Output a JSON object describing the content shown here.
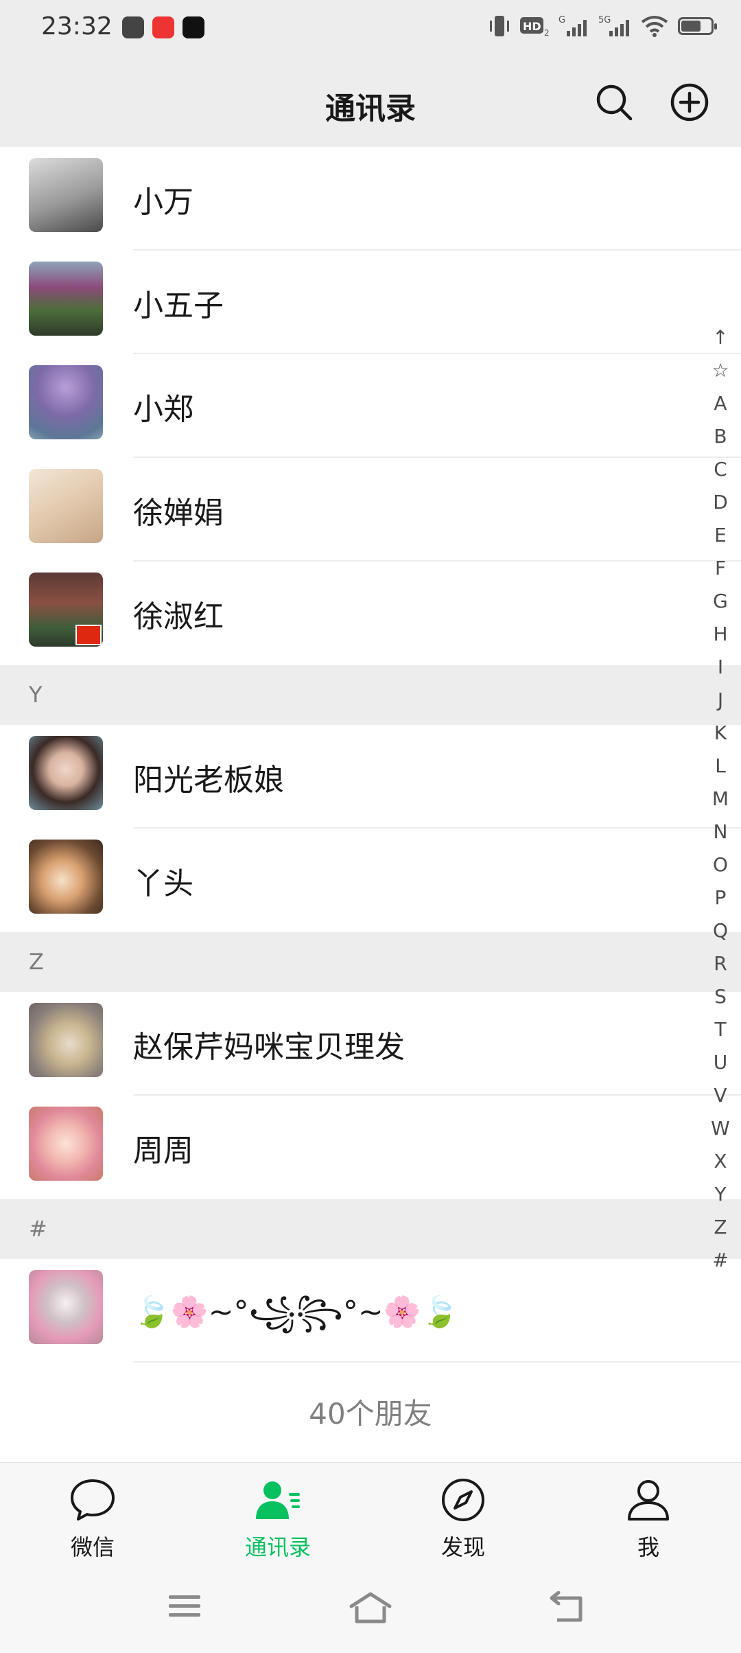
{
  "status": {
    "time": "23:32"
  },
  "header": {
    "title": "通讯录"
  },
  "contacts_top": [
    {
      "name": "小万"
    },
    {
      "name": "小五子"
    },
    {
      "name": "小郑"
    },
    {
      "name": "徐婵娟"
    },
    {
      "name": "徐淑红"
    }
  ],
  "section_y": {
    "letter": "Y"
  },
  "contacts_y": [
    {
      "name": "阳光老板娘"
    },
    {
      "name": "丫头"
    }
  ],
  "section_z": {
    "letter": "Z"
  },
  "contacts_z": [
    {
      "name": "赵保芹妈咪宝贝理发"
    },
    {
      "name": "周周"
    }
  ],
  "section_hash": {
    "letter": "#"
  },
  "contacts_hash": [
    {
      "name": "🍃🌸~°꧁꧂°~🌸🍃"
    }
  ],
  "friend_count": "40个朋友",
  "index_letters": [
    "↑",
    "☆",
    "A",
    "B",
    "C",
    "D",
    "E",
    "F",
    "G",
    "H",
    "I",
    "J",
    "K",
    "L",
    "M",
    "N",
    "O",
    "P",
    "Q",
    "R",
    "S",
    "T",
    "U",
    "V",
    "W",
    "X",
    "Y",
    "Z",
    "#"
  ],
  "tabs": [
    {
      "label": "微信"
    },
    {
      "label": "通讯录"
    },
    {
      "label": "发现"
    },
    {
      "label": "我"
    }
  ],
  "colors": {
    "accent": "#07c160",
    "header_bg": "#ededed",
    "section_bg": "#ededed"
  }
}
